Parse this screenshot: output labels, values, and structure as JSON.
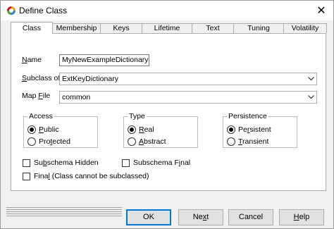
{
  "window": {
    "title": "Define Class",
    "close_glyph": "✕",
    "icon": "app-logo-icon"
  },
  "tabs": [
    {
      "label": "Class",
      "active": true
    },
    {
      "label": "Membership",
      "active": false
    },
    {
      "label": "Keys",
      "active": false
    },
    {
      "label": "Lifetime",
      "active": false
    },
    {
      "label": "Text",
      "active": false
    },
    {
      "label": "Tuning",
      "active": false
    },
    {
      "label": "Volatility",
      "active": false
    }
  ],
  "form": {
    "name": {
      "label_mnemonic": "N",
      "label_rest": "ame",
      "value": "MyNewExampleDictionary"
    },
    "subclass": {
      "label_mnemonic": "S",
      "label_rest": "ubclass of",
      "value": "ExtKeyDictionary"
    },
    "mapfile": {
      "label_pre": "Map ",
      "label_mnemonic": "F",
      "label_rest": "ile",
      "value": "common"
    }
  },
  "access": {
    "title": "Access",
    "options": [
      {
        "pre": "",
        "mnemonic": "P",
        "rest": "ublic",
        "selected": true
      },
      {
        "pre": "Pro",
        "mnemonic": "t",
        "rest": "ected",
        "selected": false
      }
    ]
  },
  "type": {
    "title": "Type",
    "options": [
      {
        "pre": "",
        "mnemonic": "R",
        "rest": "eal",
        "selected": true
      },
      {
        "pre": "",
        "mnemonic": "A",
        "rest": "bstract",
        "selected": false
      }
    ]
  },
  "persistence": {
    "title": "Persistence",
    "options": [
      {
        "pre": "Pe",
        "mnemonic": "r",
        "rest": "sistent",
        "selected": true
      },
      {
        "pre": "",
        "mnemonic": "T",
        "rest": "ransient",
        "selected": false
      }
    ]
  },
  "checks": {
    "subschema_hidden": {
      "pre": "Su",
      "mnemonic": "b",
      "rest": "schema Hidden",
      "checked": false
    },
    "subschema_final": {
      "pre": "Subschema F",
      "mnemonic": "i",
      "rest": "nal",
      "checked": false
    },
    "final": {
      "pre": "Fina",
      "mnemonic": "l",
      "rest": " (Class cannot be subclassed)",
      "checked": false
    }
  },
  "buttons": {
    "ok": "OK",
    "next_pre": "Ne",
    "next_mn": "x",
    "next_rest": "t",
    "cancel": "Cancel",
    "help_mn": "H",
    "help_rest": "elp"
  },
  "colors": {
    "focus_border": "#0078d7",
    "panel_bg": "#ffffff",
    "dialog_bg": "#f0f0f0"
  }
}
